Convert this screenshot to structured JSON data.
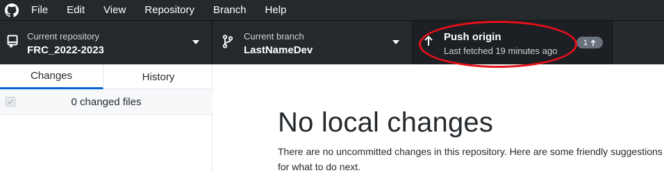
{
  "menu": {
    "items": [
      "File",
      "Edit",
      "View",
      "Repository",
      "Branch",
      "Help"
    ]
  },
  "toolbar": {
    "repository": {
      "label": "Current repository",
      "value": "FRC_2022-2023"
    },
    "branch": {
      "label": "Current branch",
      "value": "LastNameDev"
    },
    "push": {
      "title": "Push origin",
      "subtitle": "Last fetched 19 minutes ago",
      "ahead_count": "1"
    }
  },
  "sidebar": {
    "tabs": [
      "Changes",
      "History"
    ],
    "selected_tab": "Changes",
    "changed_files_text": "0 changed files"
  },
  "main": {
    "title": "No local changes",
    "description": "There are no uncommitted changes in this repository. Here are some friendly suggestions for what to do next."
  },
  "icons": {
    "app_logo": "github-logo-icon",
    "repository": "repo-icon",
    "branch": "git-branch-icon",
    "push": "arrow-up-icon"
  },
  "colors": {
    "toolbar_bg": "#24292e",
    "accent": "#0366d6",
    "annotation": "#e8101a"
  }
}
